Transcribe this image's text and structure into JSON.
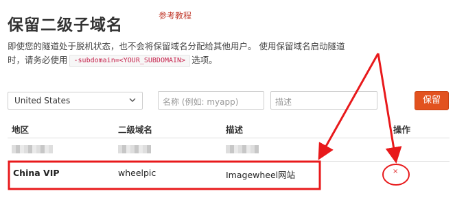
{
  "page": {
    "title": "保留二级子域名",
    "ref_link": "参考教程",
    "description_before": "即使您的隧道处于脱机状态，也不会将保留域名分配给其他用户。 使用保留域名启动隧道时，请务必使用",
    "code_flag": "-subdomain=<YOUR_SUBDOMAIN>",
    "description_after": "选项。"
  },
  "form": {
    "region_value": "United States",
    "name_placeholder": "名称 (例如: myapp)",
    "desc_placeholder": "描述",
    "reserve_label": "保留"
  },
  "table": {
    "headers": [
      "地区",
      "二级域名",
      "描述",
      "操作"
    ],
    "rows": [
      {
        "region": "China VIP",
        "subdomain": "wheelpic",
        "description": "Imagewheel网站",
        "action": "×"
      }
    ]
  },
  "colors": {
    "accent": "#e2521f",
    "annotation_red": "#e8191b",
    "delete_red": "#e03030"
  },
  "icons": {
    "select_caret": "chevron-down-icon",
    "delete": "close-icon"
  }
}
